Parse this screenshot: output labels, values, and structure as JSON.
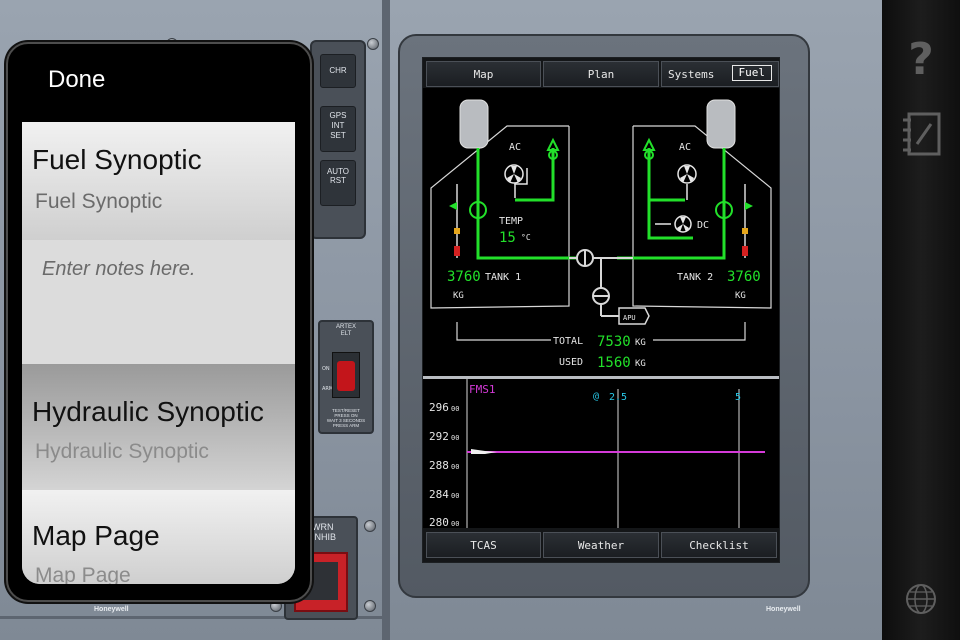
{
  "popup": {
    "done_label": "Done",
    "notes": [
      {
        "title": "Fuel Synoptic",
        "subtitle": "Fuel Synoptic"
      },
      {
        "title": "Hydraulic Synoptic",
        "subtitle": "Hydraulic Synoptic"
      },
      {
        "title": "Map Page",
        "subtitle": "Map Page"
      }
    ],
    "notes_placeholder": "Enter notes here."
  },
  "cockpit": {
    "chr_label": "CHR",
    "gps_label": "GPS\nINT",
    "set_label": "SET",
    "auto_label": "AUTO",
    "rst_label": "RST",
    "artex_label": "ARTEX\nELT",
    "artex_on": "ON",
    "artex_arm": "ARM",
    "artex_note": "TEST/RESET\nPRESS ON\nWAIT 3 SECONDS\nPRESS ARM",
    "wrn_label": "WRN\nINHIB",
    "brand": "Honeywell"
  },
  "mfd": {
    "tabs": {
      "map": "Map",
      "plan": "Plan",
      "systems": "Systems",
      "fuel": "Fuel"
    },
    "bottom_tabs": {
      "tcas": "TCAS",
      "weather": "Weather",
      "checklist": "Checklist"
    },
    "fuel": {
      "ac_left": "AC",
      "ac_right": "AC",
      "dc": "DC",
      "temp_label": "TEMP",
      "temp_value": "15",
      "temp_unit": "°C",
      "tank1_value": "3760",
      "tank1_label": "TANK 1",
      "tank1_unit": "KG",
      "tank2_value": "3760",
      "tank2_label": "TANK 2",
      "tank2_unit": "KG",
      "apu_label": "APU",
      "total_label": "TOTAL",
      "total_value": "7530",
      "total_unit": "KG",
      "used_label": "USED",
      "used_value": "1560",
      "used_unit": "KG"
    },
    "vertical": {
      "source": "FMS1",
      "marker1": "2.5",
      "marker2": "5",
      "alt_labels": [
        "296",
        "292",
        "288",
        "284",
        "280"
      ],
      "alt_suffix": "00"
    }
  },
  "sidebar": {
    "help_icon": "question-mark",
    "notes_icon": "notebook",
    "globe_icon": "globe"
  },
  "colors": {
    "fuel_green": "#22e02a",
    "fms_magenta": "#d53ad8",
    "marker_cyan": "#28c7e6"
  }
}
